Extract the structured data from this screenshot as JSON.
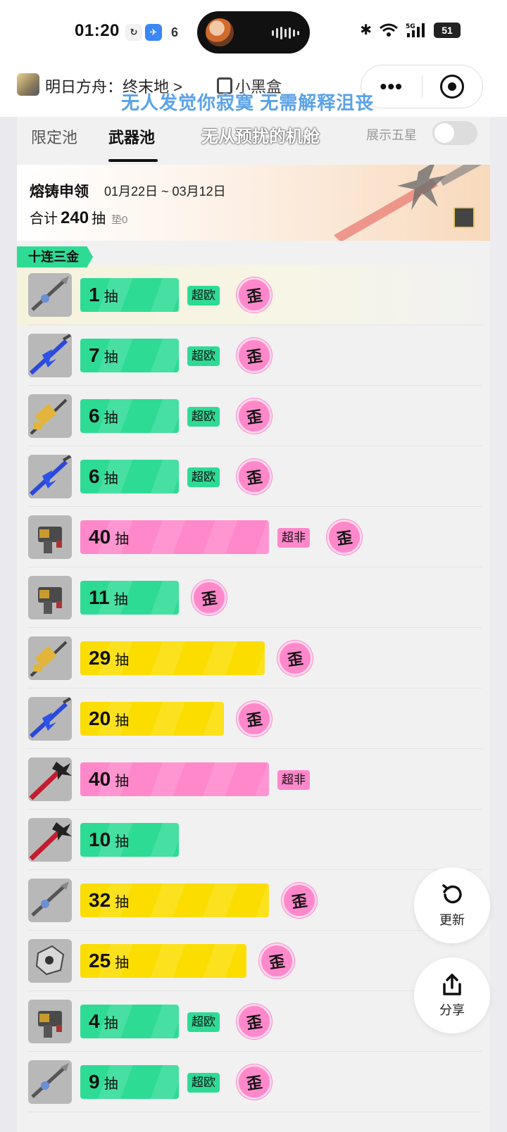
{
  "status_bar": {
    "time": "01:20",
    "battery": "51",
    "network": "5G"
  },
  "nav": {
    "app_title": "明日方舟：终末地 >",
    "brand": "小黑盒",
    "more": "•••"
  },
  "lyrics": {
    "line1": "无人发觉你寂寞  无需解释沮丧",
    "line2": "无从预扰的机舱"
  },
  "tabs": [
    {
      "label": "限定池"
    },
    {
      "label": "武器池"
    }
  ],
  "show_five_star": {
    "label": "展示五星",
    "enabled": false
  },
  "pool": {
    "name": "熔铸申领",
    "dates": "01月22日 ~ 03月12日",
    "total_prefix": "合计",
    "total": "240",
    "total_unit": "抽",
    "pad": "垫0"
  },
  "ten_pull_tag": "十连三金",
  "rows": [
    {
      "pulls": "1",
      "unit": "抽",
      "color": "green",
      "label": "超欧",
      "wai": true,
      "weapon": "silver-spear"
    },
    {
      "pulls": "7",
      "unit": "抽",
      "color": "green",
      "label": "超欧",
      "wai": true,
      "weapon": "blue-spear"
    },
    {
      "pulls": "6",
      "unit": "抽",
      "color": "green",
      "label": "超欧",
      "wai": true,
      "weapon": "gold-cannon"
    },
    {
      "pulls": "6",
      "unit": "抽",
      "color": "green",
      "label": "超欧",
      "wai": true,
      "weapon": "blue-spear"
    },
    {
      "pulls": "40",
      "unit": "抽",
      "color": "pink",
      "label": "超非",
      "wai": true,
      "weapon": "gold-gun"
    },
    {
      "pulls": "11",
      "unit": "抽",
      "color": "green",
      "label": "",
      "wai": true,
      "weapon": "gold-gun"
    },
    {
      "pulls": "29",
      "unit": "抽",
      "color": "yellow",
      "label": "",
      "wai": true,
      "weapon": "gold-cannon"
    },
    {
      "pulls": "20",
      "unit": "抽",
      "color": "yellow",
      "label": "",
      "wai": true,
      "weapon": "blue-spear"
    },
    {
      "pulls": "40",
      "unit": "抽",
      "color": "pink",
      "label": "超非",
      "wai": false,
      "weapon": "red-blade"
    },
    {
      "pulls": "10",
      "unit": "抽",
      "color": "green",
      "label": "",
      "wai": false,
      "weapon": "red-blade"
    },
    {
      "pulls": "32",
      "unit": "抽",
      "color": "yellow",
      "label": "",
      "wai": true,
      "weapon": "silver-spear"
    },
    {
      "pulls": "25",
      "unit": "抽",
      "color": "yellow",
      "label": "",
      "wai": true,
      "weapon": "silver-gauntlet"
    },
    {
      "pulls": "4",
      "unit": "抽",
      "color": "green",
      "label": "超欧",
      "wai": true,
      "weapon": "gold-gun"
    },
    {
      "pulls": "9",
      "unit": "抽",
      "color": "green",
      "label": "超欧",
      "wai": true,
      "weapon": "silver-spear"
    }
  ],
  "wai_text": "歪",
  "actions": {
    "refresh": "更新",
    "share": "分享"
  },
  "colors": {
    "green": "#2edb95",
    "pink": "#ff88cb",
    "yellow": "#fcdd00"
  }
}
